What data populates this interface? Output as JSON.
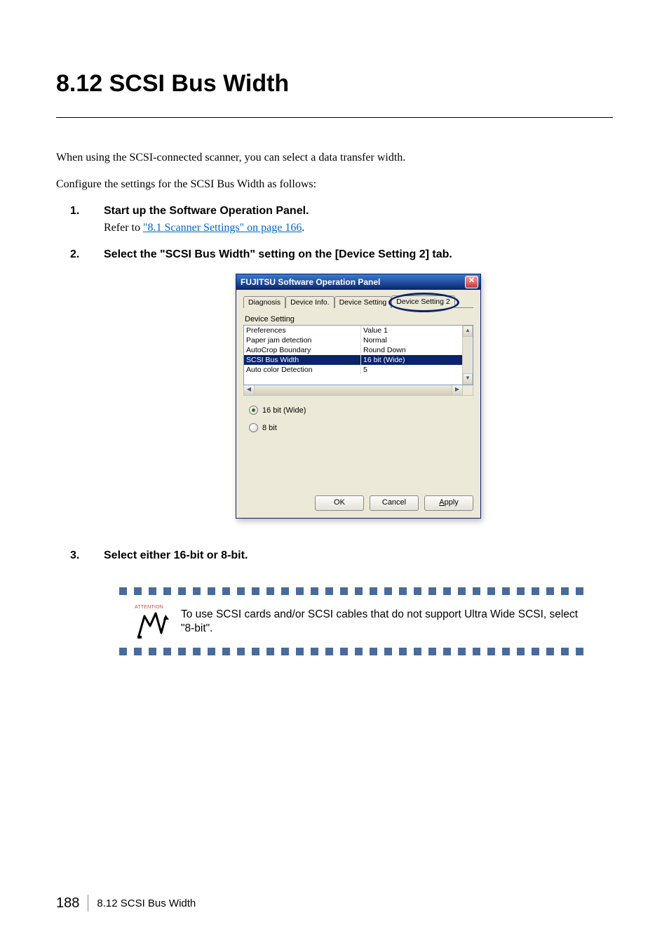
{
  "heading": "8.12 SCSI Bus Width",
  "intro1": "When using the SCSI-connected scanner, you can select a data transfer width.",
  "intro2": "Configure the settings for the SCSI Bus Width as follows:",
  "steps": [
    {
      "num": "1.",
      "title": "Start up the Software Operation Panel.",
      "ref_prefix": "Refer to ",
      "ref_link": "\"8.1 Scanner Settings\" on page 166",
      "ref_suffix": "."
    },
    {
      "num": "2.",
      "title": "Select the \"SCSI Bus Width\" setting on the [Device Setting 2] tab."
    },
    {
      "num": "3.",
      "title": "Select either 16-bit or 8-bit."
    }
  ],
  "dialog": {
    "title": "FUJITSU Software Operation Panel",
    "tabs": [
      "Diagnosis",
      "Device Info.",
      "Device Setting",
      "Device Setting 2"
    ],
    "group_label": "Device Setting",
    "rows": [
      {
        "name": "Preferences",
        "value": "Value 1"
      },
      {
        "name": "Paper jam detection",
        "value": "Normal"
      },
      {
        "name": "AutoCrop Boundary",
        "value": "Round Down"
      },
      {
        "name": "SCSI Bus Width",
        "value": "16 bit (Wide)",
        "selected": true
      },
      {
        "name": "Auto color Detection",
        "value": "5"
      }
    ],
    "radios": {
      "opt1": "16 bit (Wide)",
      "opt2": "8 bit"
    },
    "buttons": {
      "ok": "OK",
      "cancel": "Cancel",
      "apply": "Apply"
    }
  },
  "attention": {
    "label": "ATTENTION",
    "text": "To use SCSI cards and/or SCSI cables that do not support Ultra Wide SCSI, select \"8-bit\"."
  },
  "footer": {
    "page": "188",
    "title": "8.12 SCSI Bus Width"
  }
}
